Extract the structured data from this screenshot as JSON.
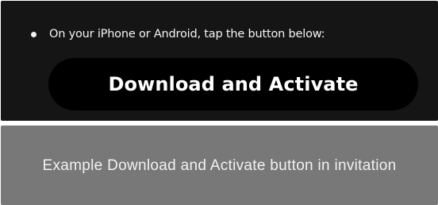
{
  "screenshot": {
    "instruction": "On your iPhone or Android, tap the button below:",
    "button_label": "Download and Activate"
  },
  "caption": {
    "text": "Example Download and Activate button in invitation"
  },
  "colors": {
    "panel": "#151515",
    "button": "#000000",
    "caption_bg": "#787878",
    "text": "#ffffff"
  }
}
